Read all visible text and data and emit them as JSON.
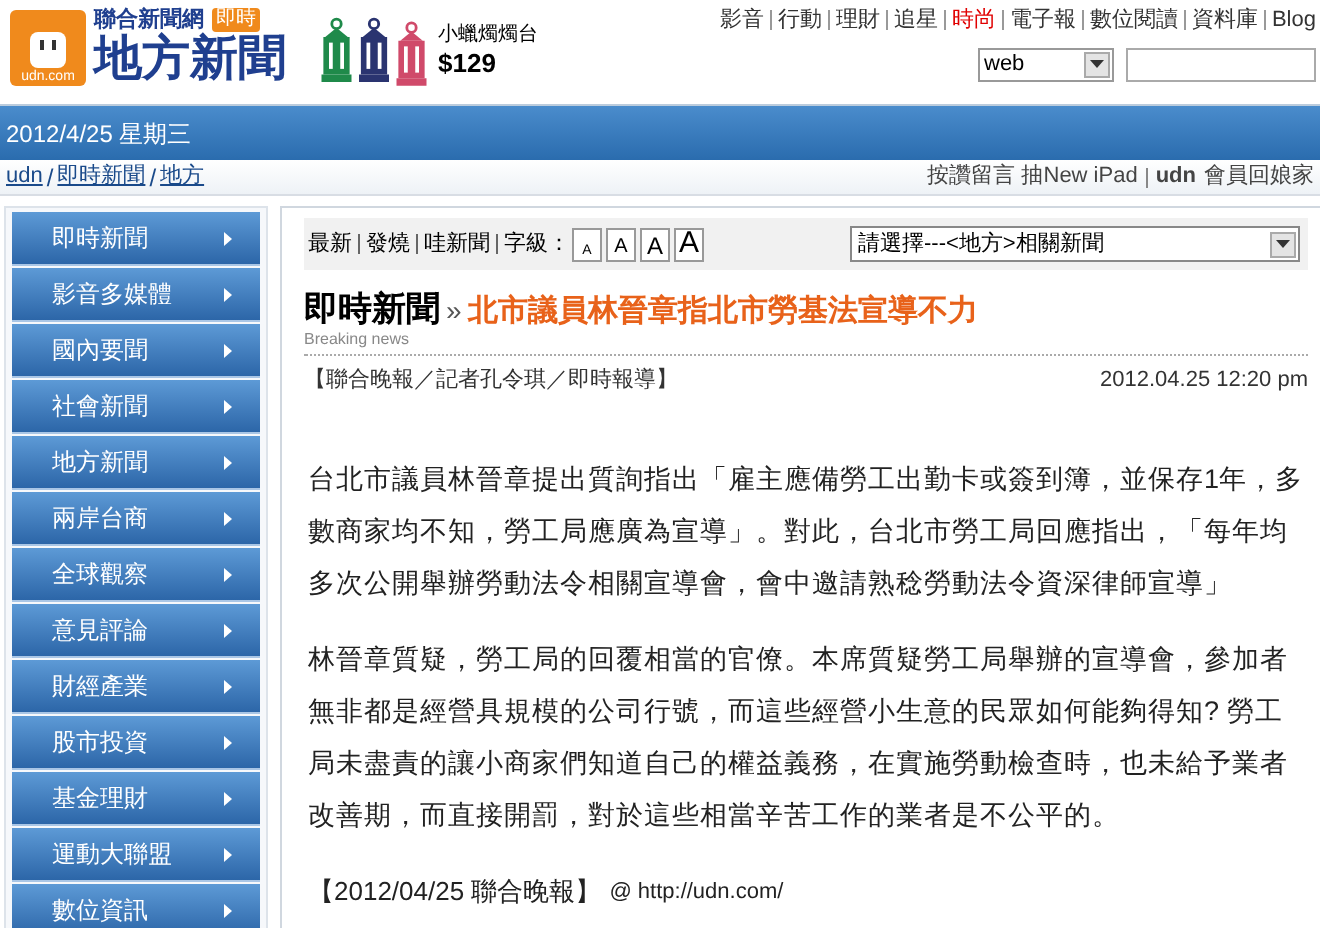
{
  "logo": {
    "domain": "udn.com",
    "brand": "聯合新聞網",
    "badge": "即時",
    "section": "地方新聞"
  },
  "ad": {
    "product": "小蠟燭燭台",
    "price": "$129"
  },
  "top_links": [
    {
      "label": "影音",
      "active": false
    },
    {
      "label": "行動",
      "active": false
    },
    {
      "label": "理財",
      "active": false
    },
    {
      "label": "追星",
      "active": false
    },
    {
      "label": "時尚",
      "active": true
    },
    {
      "label": "電子報",
      "active": false
    },
    {
      "label": "數位閱讀",
      "active": false
    },
    {
      "label": "資料庫",
      "active": false
    },
    {
      "label": "Blog",
      "active": false
    }
  ],
  "search": {
    "scope": "web"
  },
  "date_bar": {
    "date": "2012/4/25 星期三"
  },
  "breadcrumb": {
    "items": [
      "udn",
      "即時新聞",
      "地方"
    ],
    "separator": "/",
    "promo": "按讚留言 抽New iPad",
    "promo_brand": "udn",
    "promo_tail": "會員回娘家"
  },
  "sidebar": {
    "items": [
      "即時新聞",
      "影音多媒體",
      "國內要聞",
      "社會新聞",
      "地方新聞",
      "兩岸台商",
      "全球觀察",
      "意見評論",
      "財經產業",
      "股市投資",
      "基金理財",
      "運動大聯盟",
      "數位資訊"
    ]
  },
  "toolbar": {
    "links": [
      "最新",
      "發燒",
      "哇新聞"
    ],
    "font_label": "字級：",
    "font_sizes": [
      "A",
      "A",
      "A",
      "A"
    ],
    "related": "請選擇---<地方>相關新聞"
  },
  "article": {
    "section": "即時新聞",
    "section_en": "Breaking news",
    "chevron": "»",
    "headline": "北市議員林晉章指北市勞基法宣導不力",
    "byline": "【聯合晚報／記者孔令琪／即時報導】",
    "datetime": "2012.04.25 12:20 pm",
    "paragraphs": [
      "台北市議員林晉章提出質詢指出「雇主應備勞工出勤卡或簽到簿，並保存1年，多數商家均不知，勞工局應廣為宣導」。對此，台北市勞工局回應指出，「每年均多次公開舉辦勞動法令相關宣導會，會中邀請熟稔勞動法令資深律師宣導」",
      "林晉章質疑，勞工局的回覆相當的官僚。本席質疑勞工局舉辦的宣導會，參加者無非都是經營具規模的公司行號，而這些經營小生意的民眾如何能夠得知? 勞工局未盡責的讓小商家們知道自己的權益義務，在實施勞動檢查時，也未給予業者改善期，而直接開罰，對於這些相當辛苦工作的業者是不公平的。"
    ],
    "source": "【2012/04/25 聯合晚報】",
    "source_link": "@ http://udn.com/"
  }
}
